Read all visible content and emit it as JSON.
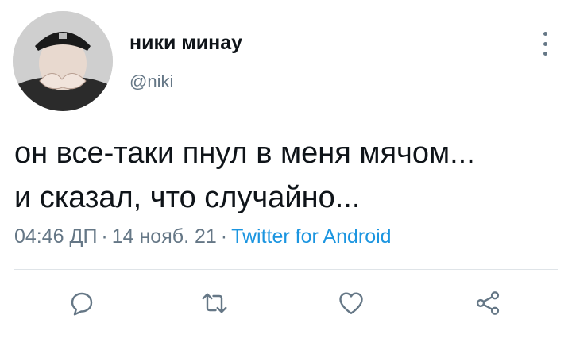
{
  "tweet": {
    "author": {
      "display_name": "ники минау",
      "handle": "@niki",
      "avatar": "profile-photo"
    },
    "text_lines": [
      "он все-таки пнул в меня мячом...",
      "и сказал, что случайно..."
    ],
    "meta": {
      "time": "04:46 ДП",
      "separator": "·",
      "date": "14 нояб. 21",
      "source": "Twitter for Android"
    },
    "actions": [
      {
        "name": "reply",
        "icon": "reply-icon"
      },
      {
        "name": "retweet",
        "icon": "retweet-icon"
      },
      {
        "name": "like",
        "icon": "heart-icon"
      },
      {
        "name": "share",
        "icon": "share-icon"
      }
    ]
  },
  "colors": {
    "text": "#0f1419",
    "secondary": "#657786",
    "link": "#1b95e0",
    "divider": "#dfe4e8"
  }
}
